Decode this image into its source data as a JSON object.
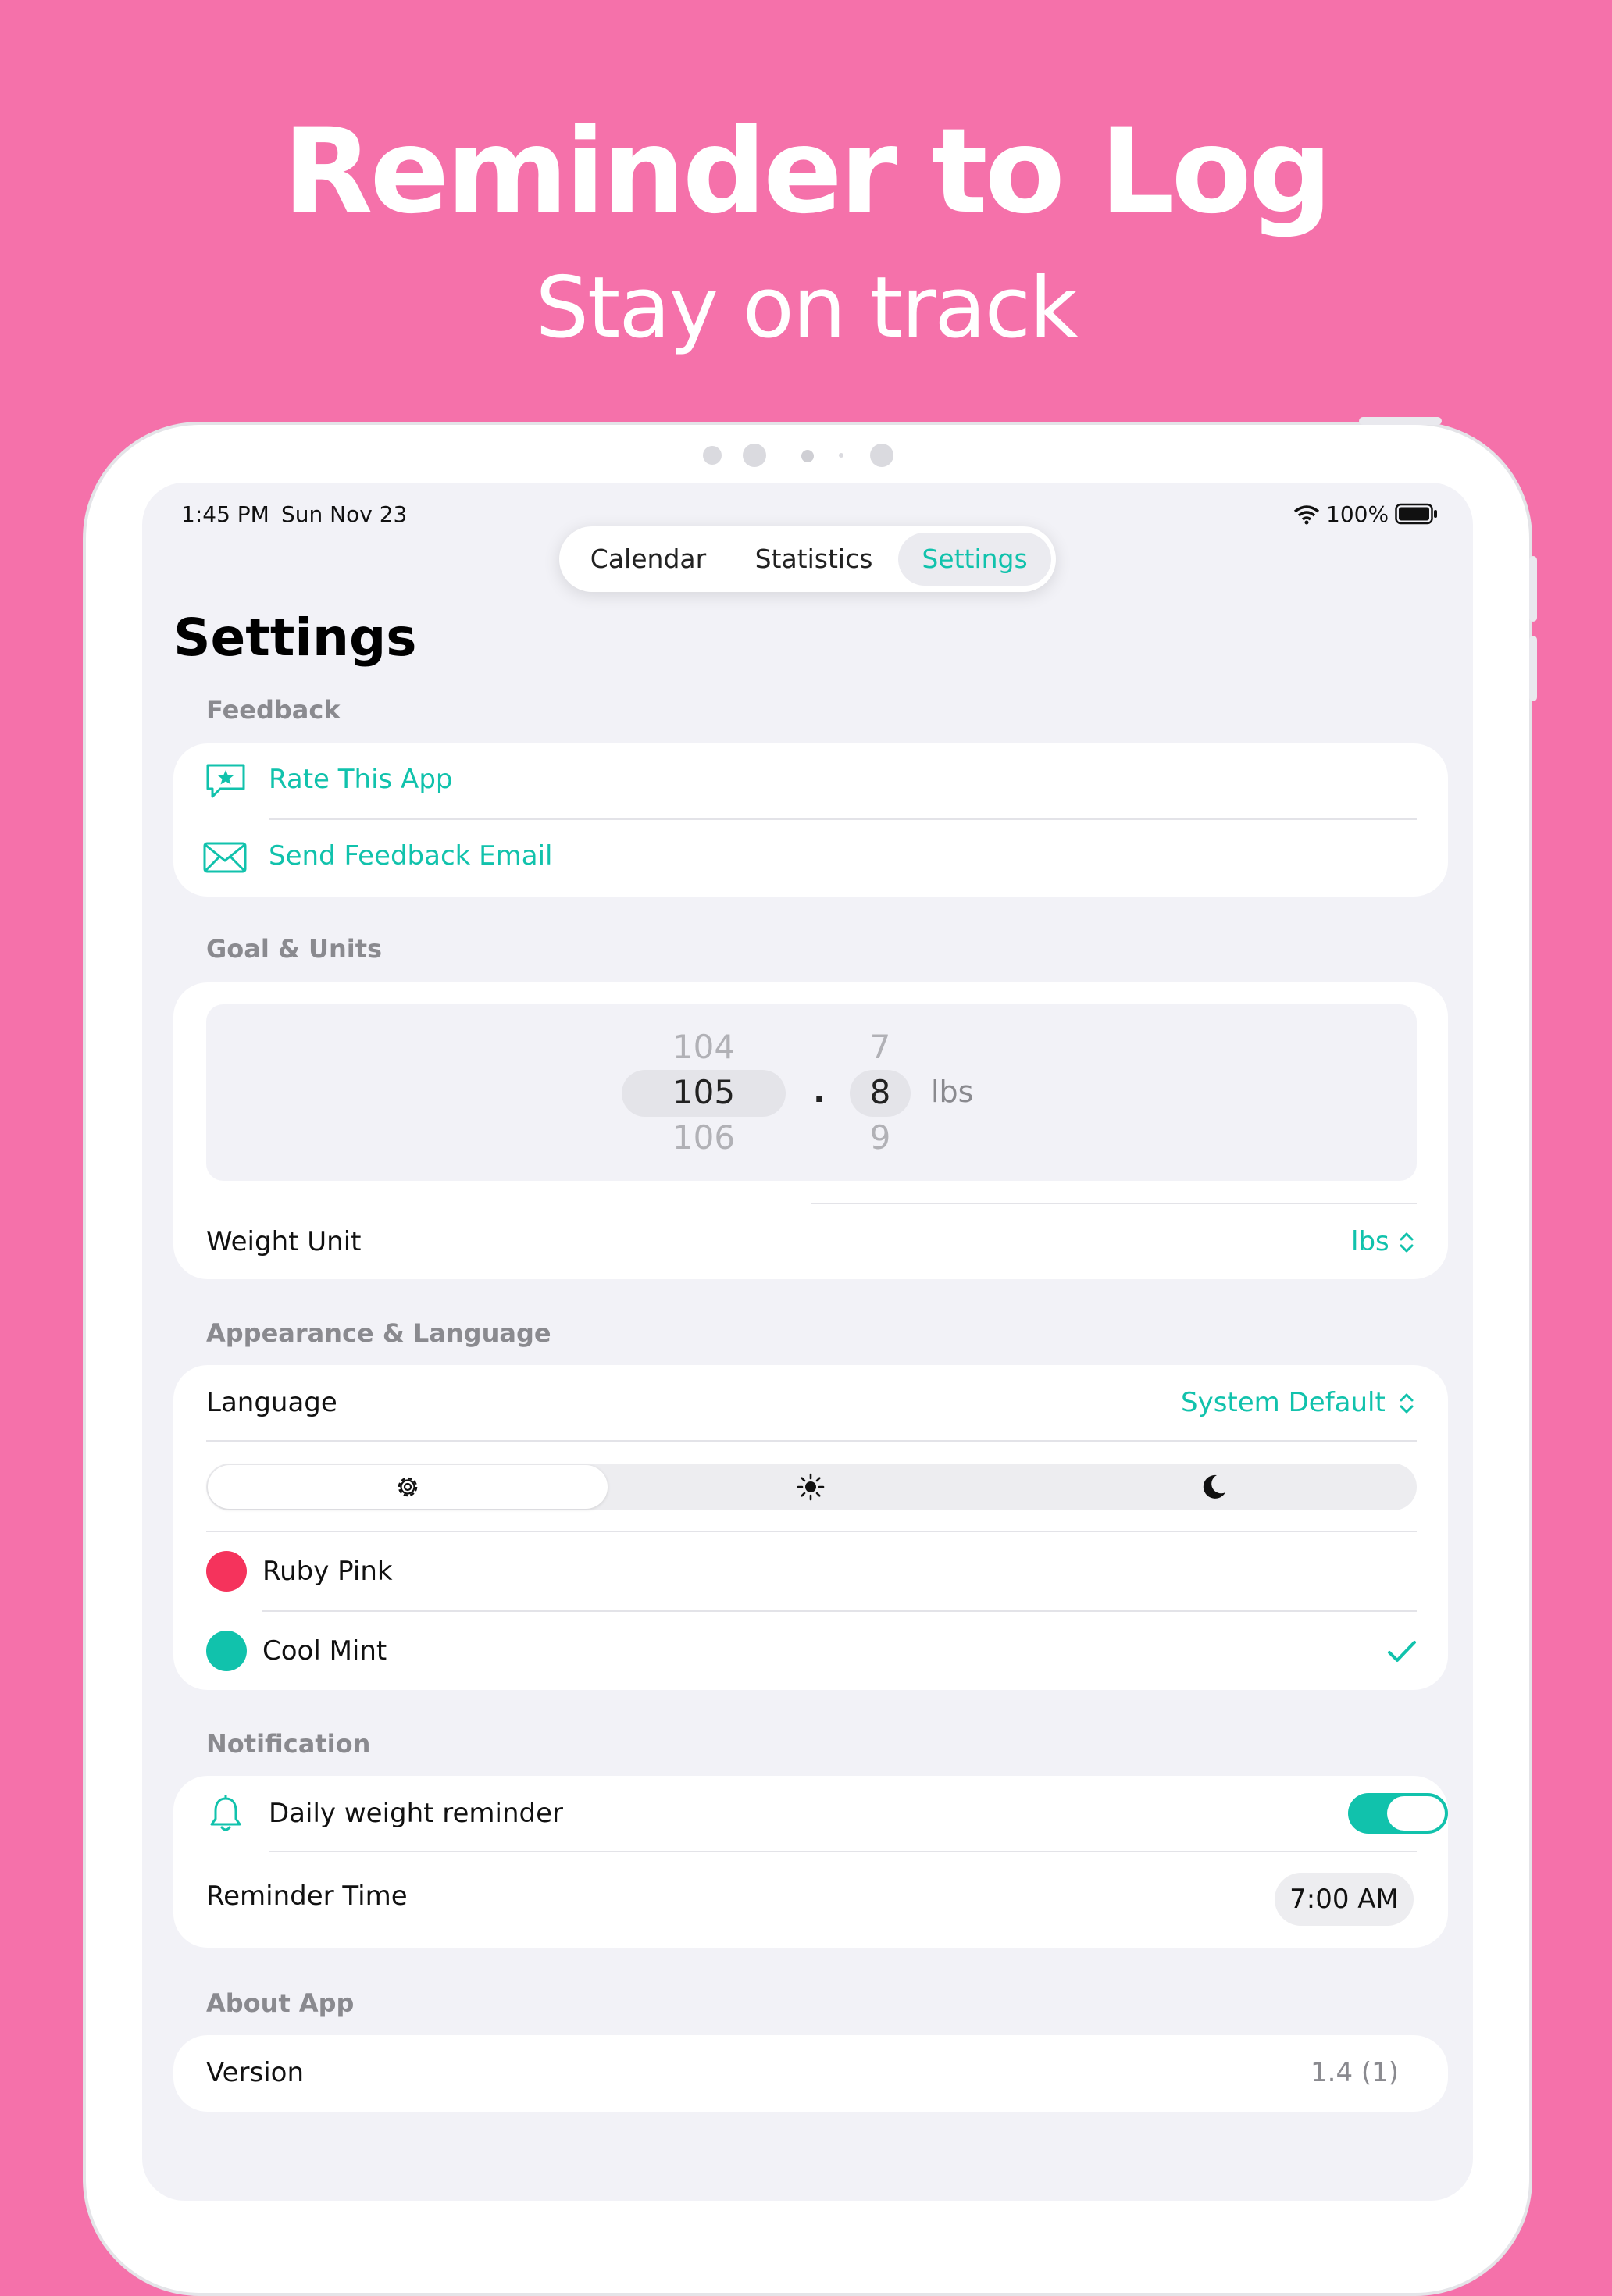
{
  "hero": {
    "title": "Reminder to Log",
    "subtitle": "Stay on track"
  },
  "status_bar": {
    "time": "1:45 PM",
    "date": "Sun Nov 23",
    "battery": "100%"
  },
  "tabs": [
    {
      "label": "Calendar"
    },
    {
      "label": "Statistics"
    },
    {
      "label": "Settings",
      "active": true
    }
  ],
  "page_title": "Settings",
  "feedback": {
    "header": "Feedback",
    "rate_label": "Rate This App",
    "email_label": "Send Feedback Email"
  },
  "goal": {
    "header": "Goal & Units",
    "picker": {
      "whole_prev": "104",
      "whole_selected": "105",
      "whole_next": "106",
      "dot": ".",
      "decimal_prev": "7",
      "decimal_selected": "8",
      "decimal_next": "9",
      "unit": "lbs"
    },
    "weight_unit_label": "Weight Unit",
    "weight_unit_value": "lbs"
  },
  "appearance": {
    "header": "Appearance & Language",
    "language_label": "Language",
    "language_value": "System Default",
    "theme_options": [
      "gear-icon",
      "sun-icon",
      "moon-icon"
    ],
    "themes": [
      {
        "label": "Ruby Pink",
        "color": "#f5335c",
        "selected": false
      },
      {
        "label": "Cool Mint",
        "color": "#11c2ac",
        "selected": true
      }
    ]
  },
  "notification": {
    "header": "Notification",
    "daily_label": "Daily weight reminder",
    "daily_enabled": true,
    "time_label": "Reminder Time",
    "time_value": "7:00 AM"
  },
  "about": {
    "header": "About App",
    "version_label": "Version",
    "version_value": "1.4 (1)"
  },
  "colors": {
    "background": "#f571aa",
    "accent": "#11c2ac",
    "screen": "#f2f2f7"
  }
}
